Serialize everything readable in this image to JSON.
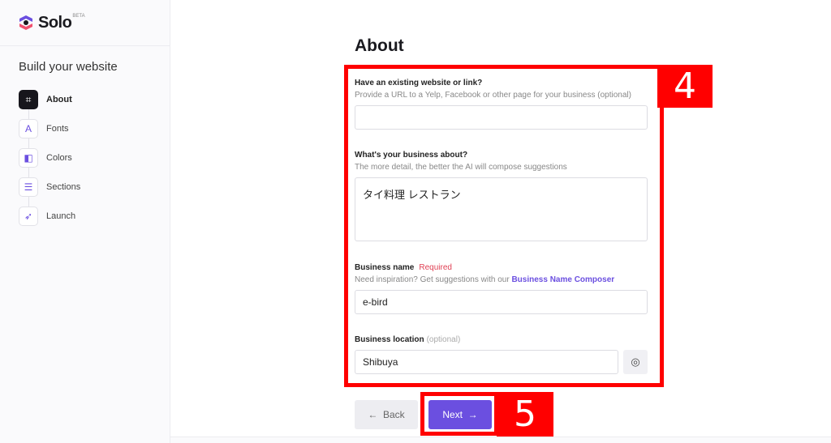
{
  "brand": {
    "name": "Solo",
    "badge": "BETA"
  },
  "sidebar": {
    "title": "Build your website",
    "steps": [
      {
        "label": "About",
        "icon": "crop-icon",
        "active": true
      },
      {
        "label": "Fonts",
        "icon": "font-icon"
      },
      {
        "label": "Colors",
        "icon": "palette-icon"
      },
      {
        "label": "Sections",
        "icon": "layout-icon"
      },
      {
        "label": "Launch",
        "icon": "rocket-icon"
      }
    ]
  },
  "main": {
    "title": "About",
    "website": {
      "label": "Have an existing website or link?",
      "help": "Provide a URL to a Yelp, Facebook or other page for your business (optional)",
      "value": ""
    },
    "about": {
      "label": "What's your business about?",
      "help": "The more detail, the better the AI will compose suggestions",
      "value": "タイ料理 レストラン"
    },
    "name": {
      "label": "Business name",
      "required": "Required",
      "help": "Need inspiration? Get suggestions with our",
      "link": "Business Name Composer",
      "value": "e-bird"
    },
    "location": {
      "label": "Business location",
      "optional": "(optional)",
      "value": "Shibuya",
      "button_icon": "locate-icon"
    },
    "back_label": "Back",
    "next_label": "Next"
  },
  "annotations": {
    "a4": "4",
    "a5": "5",
    "color": "#ff0000"
  },
  "colors": {
    "accent": "#6b4fe0",
    "required": "#e04054"
  }
}
